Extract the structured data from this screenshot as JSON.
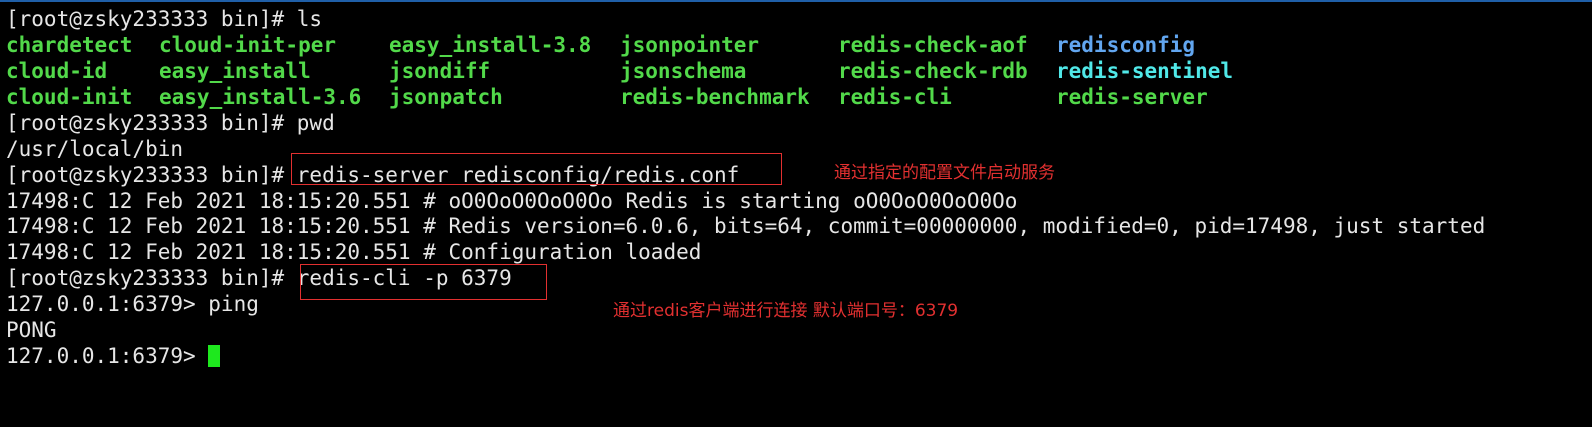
{
  "colors": {
    "text": "#e6e6e6",
    "ls_green": "#52d94a",
    "ls_blue": "#62a6f0",
    "ls_cyan": "#50e8e8",
    "annotation_red": "#e23030",
    "cursor": "#1ee81e",
    "window_border": "#1f5fa8"
  },
  "terminal": {
    "lines": [
      "[root@zsky233333 bin]# ls",
      "[root@zsky233333 bin]# pwd",
      "/usr/local/bin",
      "[root@zsky233333 bin]# redis-server redisconfig/redis.conf",
      "17498:C 12 Feb 2021 18:15:20.551 # oO0OoO0OoO0Oo Redis is starting oO0OoO0OoO0Oo",
      "17498:C 12 Feb 2021 18:15:20.551 # Redis version=6.0.6, bits=64, commit=00000000, modified=0, pid=17498, just started",
      "17498:C 12 Feb 2021 18:15:20.551 # Configuration loaded",
      "[root@zsky233333 bin]# redis-cli -p 6379",
      "127.0.0.1:6379> ping",
      "PONG",
      "127.0.0.1:6379> "
    ],
    "ls_output": [
      [
        {
          "name": "chardetect",
          "color": "green"
        },
        {
          "name": "cloud-init-per",
          "color": "green"
        },
        {
          "name": "easy_install-3.8",
          "color": "green"
        },
        {
          "name": "jsonpointer",
          "color": "green"
        },
        {
          "name": "redis-check-aof",
          "color": "green"
        },
        {
          "name": "redisconfig",
          "color": "blue"
        }
      ],
      [
        {
          "name": "cloud-id",
          "color": "green"
        },
        {
          "name": "easy_install",
          "color": "green"
        },
        {
          "name": "jsondiff",
          "color": "green"
        },
        {
          "name": "jsonschema",
          "color": "green"
        },
        {
          "name": "redis-check-rdb",
          "color": "green"
        },
        {
          "name": "redis-sentinel",
          "color": "cyan"
        }
      ],
      [
        {
          "name": "cloud-init",
          "color": "green"
        },
        {
          "name": "easy_install-3.6",
          "color": "green"
        },
        {
          "name": "jsonpatch",
          "color": "green"
        },
        {
          "name": "redis-benchmark",
          "color": "green"
        },
        {
          "name": "redis-cli",
          "color": "green"
        },
        {
          "name": "redis-server",
          "color": "green"
        }
      ]
    ]
  },
  "annotations": [
    {
      "text": "通过指定的配置文件启动服务"
    },
    {
      "text": "通过redis客户端进行连接 默认端口号：6379"
    }
  ]
}
